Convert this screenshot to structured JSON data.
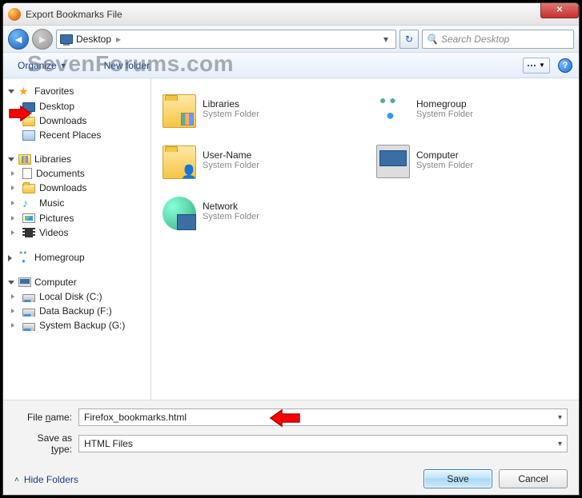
{
  "window": {
    "title": "Export Bookmarks File"
  },
  "nav": {
    "location_icon": "desktop",
    "crumbs": [
      "Desktop"
    ],
    "refresh_tip": "Refresh",
    "search_placeholder": "Search Desktop"
  },
  "toolbar": {
    "organize": "Organize",
    "new_folder": "New folder"
  },
  "watermark": "SevenForums.com",
  "sidebar": {
    "favorites": {
      "label": "Favorites",
      "items": [
        {
          "label": "Desktop",
          "icon": "desktop"
        },
        {
          "label": "Downloads",
          "icon": "folder"
        },
        {
          "label": "Recent Places",
          "icon": "recent"
        }
      ]
    },
    "libraries": {
      "label": "Libraries",
      "items": [
        {
          "label": "Documents",
          "icon": "doc"
        },
        {
          "label": "Downloads",
          "icon": "folder"
        },
        {
          "label": "Music",
          "icon": "music"
        },
        {
          "label": "Pictures",
          "icon": "pic"
        },
        {
          "label": "Videos",
          "icon": "vid"
        }
      ]
    },
    "homegroup": {
      "label": "Homegroup"
    },
    "computer": {
      "label": "Computer",
      "items": [
        {
          "label": "Local Disk (C:)",
          "icon": "drive"
        },
        {
          "label": "Data Backup (F:)",
          "icon": "drive"
        },
        {
          "label": "System Backup (G:)",
          "icon": "drive"
        }
      ]
    }
  },
  "content_items": [
    {
      "name": "Libraries",
      "sub": "System Folder",
      "icon": "lib"
    },
    {
      "name": "Homegroup",
      "sub": "System Folder",
      "icon": "hg"
    },
    {
      "name": "User-Name",
      "sub": "System Folder",
      "icon": "user"
    },
    {
      "name": "Computer",
      "sub": "System Folder",
      "icon": "comp"
    },
    {
      "name": "Network",
      "sub": "System Folder",
      "icon": "net"
    }
  ],
  "filename": {
    "label": "File name:",
    "value": "Firefox_bookmarks.html"
  },
  "savetype": {
    "label": "Save as type:",
    "value": "HTML Files"
  },
  "buttons": {
    "save": "Save",
    "cancel": "Cancel",
    "hide_folders": "Hide Folders"
  }
}
